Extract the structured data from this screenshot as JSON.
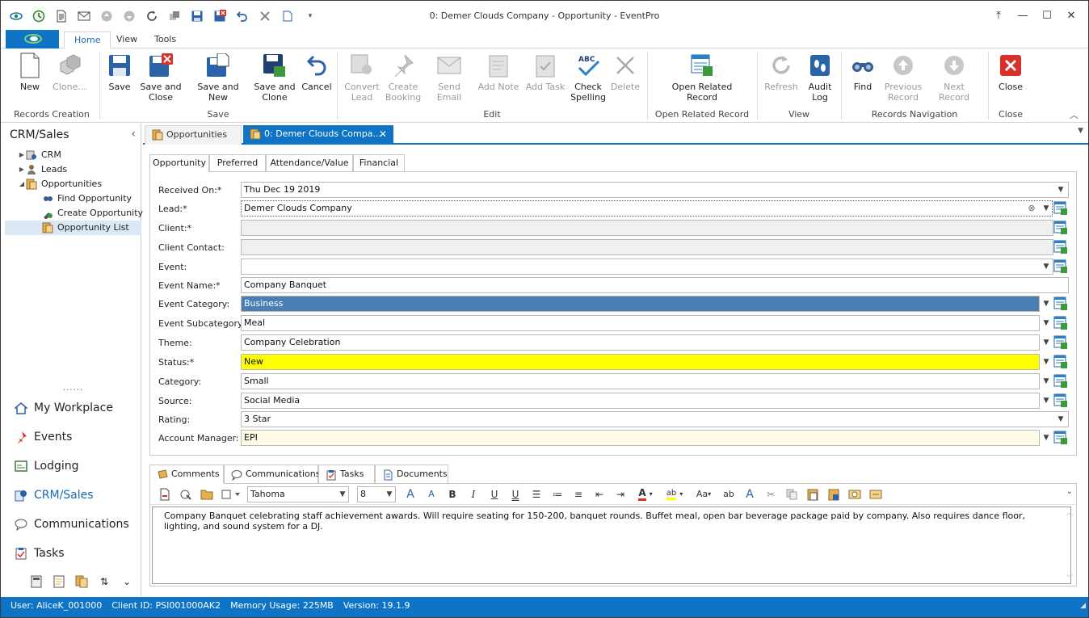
{
  "window": {
    "title": "0: Demer Clouds Company - Opportunity - EventPro"
  },
  "ribbon_tabs": [
    "Home",
    "View",
    "Tools"
  ],
  "ribbon": {
    "buttons": [
      {
        "label": "New",
        "icon": "new-document-icon"
      },
      {
        "label": "Clone...",
        "icon": "clone-icon"
      },
      {
        "label": "Save",
        "icon": "save-icon"
      },
      {
        "label": "Save and\nClose",
        "icon": "save-close-icon"
      },
      {
        "label": "Save and New",
        "icon": "save-new-icon"
      },
      {
        "label": "Save and\nClone",
        "icon": "save-clone-icon"
      },
      {
        "label": "Cancel",
        "icon": "undo-icon"
      },
      {
        "label": "Convert\nLead",
        "icon": "convert-lead-icon"
      },
      {
        "label": "Create\nBooking",
        "icon": "pin-icon"
      },
      {
        "label": "Send Email",
        "icon": "email-icon"
      },
      {
        "label": "Add Note",
        "icon": "note-icon"
      },
      {
        "label": "Add Task",
        "icon": "task-icon"
      },
      {
        "label": "Check\nSpelling",
        "icon": "spellcheck-icon"
      },
      {
        "label": "Delete",
        "icon": "delete-icon"
      },
      {
        "label": "Open Related\nRecord",
        "icon": "related-record-icon"
      },
      {
        "label": "Refresh",
        "icon": "refresh-icon"
      },
      {
        "label": "Audit\nLog",
        "icon": "audit-log-icon"
      },
      {
        "label": "Find",
        "icon": "binoculars-icon"
      },
      {
        "label": "Previous\nRecord",
        "icon": "arrow-up-icon"
      },
      {
        "label": "Next Record",
        "icon": "arrow-down-icon"
      },
      {
        "label": "Close",
        "icon": "close-red-icon"
      }
    ],
    "groups": [
      "Records Creation",
      "Save",
      "Edit",
      "Open Related Record",
      "View",
      "Records Navigation",
      "Close"
    ]
  },
  "nav": {
    "title": "CRM/Sales",
    "tree": [
      {
        "label": "CRM"
      },
      {
        "label": "Leads"
      },
      {
        "label": "Opportunities"
      },
      {
        "label": "Find Opportunity"
      },
      {
        "label": "Create Opportunity"
      },
      {
        "label": "Opportunity List"
      }
    ],
    "splitter": "......",
    "modules": [
      {
        "label": "My Workplace"
      },
      {
        "label": "Events"
      },
      {
        "label": "Lodging"
      },
      {
        "label": "CRM/Sales"
      },
      {
        "label": "Communications"
      },
      {
        "label": "Tasks"
      }
    ]
  },
  "doc_tabs": [
    {
      "label": "Opportunities"
    },
    {
      "label": "0: Demer Clouds Compa..."
    }
  ],
  "form_tabs": [
    "Opportunity",
    "Preferred",
    "Attendance/Value",
    "Financial"
  ],
  "fields": [
    {
      "label": "Received On:*",
      "value": "Thu Dec 19 2019"
    },
    {
      "label": "Lead:*",
      "value": "Demer Clouds Company"
    },
    {
      "label": "Client:*",
      "value": ""
    },
    {
      "label": "Client Contact:",
      "value": ""
    },
    {
      "label": "Event:",
      "value": ""
    },
    {
      "label": "Event Name:*",
      "value": "Company Banquet"
    },
    {
      "label": "Event Category:",
      "value": "Business"
    },
    {
      "label": "Event Subcategory:",
      "value": "Meal"
    },
    {
      "label": "Theme:",
      "value": "Company Celebration"
    },
    {
      "label": "Status:*",
      "value": "New"
    },
    {
      "label": "Category:",
      "value": "Small"
    },
    {
      "label": "Source:",
      "value": "Social Media"
    },
    {
      "label": "Rating:",
      "value": "3 Star"
    },
    {
      "label": "Account Manager:",
      "value": "EPI"
    }
  ],
  "colors": {
    "accent": "#0f74c5",
    "status_new": "#ffff00",
    "category_selected": "#4a7fb5",
    "account_manager_bg": "#fffbe6"
  },
  "comment_tabs": [
    "Comments",
    "Communications",
    "Tasks",
    "Documents"
  ],
  "editor": {
    "font": "Tahoma",
    "size": "8",
    "text": "Company Banquet celebrating staff achievement awards.  Will require seating for 150-200, banquet rounds. Buffet meal, open bar beverage package paid by company. Also requires dance floor, lighting, and sound system for a DJ."
  },
  "status": {
    "user": "User: AliceK_001000",
    "client_id": "Client ID: PSI001000AK2",
    "memory": "Memory Usage: 225MB",
    "version": "Version: 19.1.9"
  }
}
